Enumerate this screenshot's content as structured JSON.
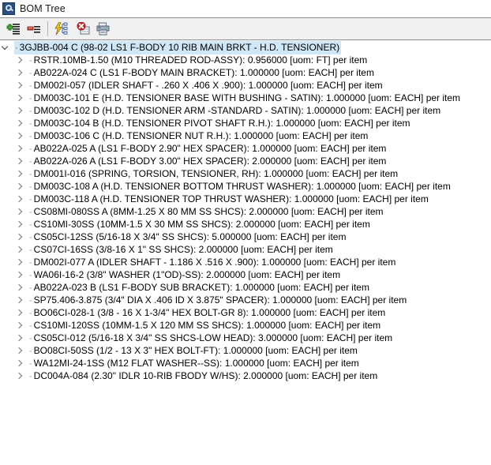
{
  "window": {
    "title": "BOM Tree",
    "icon": "app-icon"
  },
  "toolbar": {
    "buttons": [
      {
        "name": "add-row-button",
        "icon": "add-list-icon",
        "tooltip": "Add"
      },
      {
        "name": "remove-row-button",
        "icon": "remove-list-icon",
        "tooltip": "Remove"
      },
      {
        "name": "expand-all-button",
        "icon": "lightning-tree-icon",
        "tooltip": "Expand"
      },
      {
        "name": "delete-button",
        "icon": "delete-red-x-icon",
        "tooltip": "Delete"
      },
      {
        "name": "print-button",
        "icon": "printer-icon",
        "tooltip": "Print"
      }
    ]
  },
  "tree": {
    "root": {
      "expanded": true,
      "selected": true,
      "text": "3GJBB-004 C (98-02 LS1 F-BODY 10 RIB MAIN BRKT - H.D. TENSIONER)"
    },
    "children": [
      {
        "text": "RSTR.10MB-1.50  (M10 THREADED ROD-ASSY):  0.956000 [uom: FT]  per item"
      },
      {
        "text": "AB022A-024 C (LS1 F-BODY MAIN BRACKET):  1.000000 [uom: EACH]  per item"
      },
      {
        "text": "DM002I-057  (IDLER SHAFT - .260 X .406 X .900):  1.000000 [uom: EACH]  per item"
      },
      {
        "text": "DM003C-101 E (H.D. TENSIONER BASE WITH BUSHING - SATIN):  1.000000 [uom: EACH]  per item"
      },
      {
        "text": "DM003C-102 D (H.D. TENSIONER ARM -STANDARD - SATIN):  1.000000 [uom: EACH]  per item"
      },
      {
        "text": "DM003C-104 B (H.D. TENSIONER PIVOT SHAFT R.H.):  1.000000 [uom: EACH]  per item"
      },
      {
        "text": "DM003C-106 C (H.D. TENSIONER NUT R.H.):  1.000000 [uom: EACH]  per item"
      },
      {
        "text": "AB022A-025 A (LS1 F-BODY 2.90\" HEX SPACER):  1.000000 [uom: EACH]  per item"
      },
      {
        "text": "AB022A-026 A (LS1 F-BODY 3.00\" HEX SPACER):  2.000000 [uom: EACH]  per item"
      },
      {
        "text": "DM001I-016  (SPRING, TORSION, TENSIONER, RH):  1.000000 [uom: EACH]  per item"
      },
      {
        "text": "DM003C-108 A (H.D. TENSIONER BOTTOM THRUST WASHER):  1.000000 [uom: EACH]  per item"
      },
      {
        "text": "DM003C-118 A (H.D. TENSIONER TOP THRUST WASHER):  1.000000 [uom: EACH]  per item"
      },
      {
        "text": "CS08MI-080SS A (8MM-1.25 X 80 MM SS SHCS):  2.000000 [uom: EACH]  per item"
      },
      {
        "text": "CS10MI-30SS  (10MM-1.5 X 30 MM SS SHCS):  2.000000 [uom: EACH]  per item"
      },
      {
        "text": "CS05CI-12SS  (5/16-18 X 3/4\" SS SHCS):  5.000000 [uom: EACH]  per item"
      },
      {
        "text": "CS07CI-16SS  (3/8-16 X 1\" SS SHCS):  2.000000 [uom: EACH]  per item"
      },
      {
        "text": "DM002I-077 A (IDLER SHAFT - 1.186 X .516 X .900):  1.000000 [uom: EACH]  per item"
      },
      {
        "text": "WA06I-16-2  (3/8\"  WASHER (1\"OD)-SS):  2.000000 [uom: EACH]  per item"
      },
      {
        "text": "AB022A-023 B (LS1 F-BODY SUB BRACKET):  1.000000 [uom: EACH]  per item"
      },
      {
        "text": "SP75.406-3.875  (3/4\" DIA X .406 ID X 3.875\" SPACER):  1.000000 [uom: EACH]  per item"
      },
      {
        "text": "BO06CI-028-1  (3/8 - 16 X 1-3/4\" HEX BOLT-GR 8):  1.000000 [uom: EACH]  per item"
      },
      {
        "text": "CS10MI-120SS  (10MM-1.5 X 120 MM SS SHCS):  1.000000 [uom: EACH]  per item"
      },
      {
        "text": "CS05CI-012  (5/16-18 X 3/4\" SS SHCS-LOW HEAD):  3.000000 [uom: EACH]  per item"
      },
      {
        "text": "BO08CI-50SS  (1/2 - 13 X 3\" HEX BOLT-FT):  1.000000 [uom: EACH]  per item"
      },
      {
        "text": "WA12MI-24-1SS  (M12 FLAT WASHER--SS):  1.000000 [uom: EACH]  per item"
      },
      {
        "text": "DC004A-084  (2.30\" IDLR 10-RIB FBODY W/HS):  2.000000 [uom: EACH]  per item"
      }
    ]
  },
  "colors": {
    "selection": "#cfe7f7",
    "toolbar_bg": "#f0f0f0",
    "toolbar_border": "#8a8f98",
    "text": "#000000"
  }
}
